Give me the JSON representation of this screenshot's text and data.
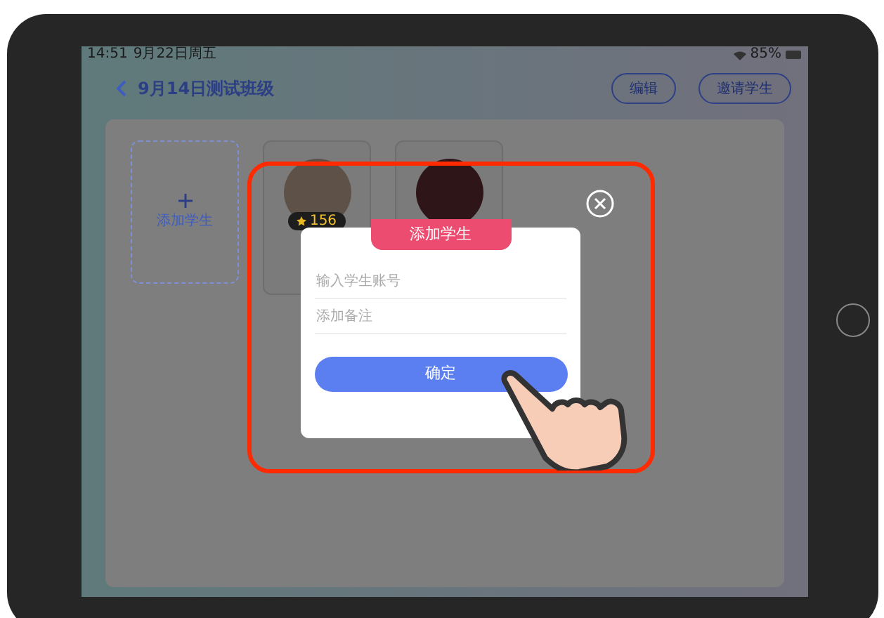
{
  "status_bar": {
    "time": "14:51",
    "date": "9月22日周五",
    "battery": "85%"
  },
  "header": {
    "title": "9月14日测试班级",
    "buttons": [
      "编辑",
      "邀请学生"
    ]
  },
  "students": {
    "add_label": "添加学生",
    "cards": [
      {
        "kind": "scored",
        "score": "156"
      },
      {
        "kind": "plain"
      }
    ]
  },
  "dialog": {
    "title": "添加学生",
    "fields": [
      {
        "placeholder": "输入学生账号"
      },
      {
        "placeholder": "添加备注"
      }
    ],
    "confirm": "确定"
  }
}
